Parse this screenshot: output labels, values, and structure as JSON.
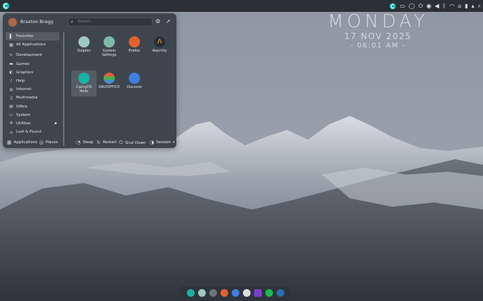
{
  "panel": {
    "tray_icons": [
      "cachyos-icon",
      "monitor-icon",
      "circle-icon",
      "power-icon",
      "eye-icon",
      "volume-icon",
      "bluetooth-icon",
      "wifi-icon",
      "hub-icon",
      "battery-icon",
      "expand-icon",
      "search-icon"
    ]
  },
  "clock": {
    "day": "MONDAY",
    "date": "17 NOV 2025",
    "time": "- 06:01 AM -"
  },
  "menu": {
    "user_name": "Braxton Bragg",
    "search_placeholder": "Search...",
    "categories": [
      {
        "label": "Favorites",
        "icon": "bookmark-icon"
      },
      {
        "label": "All Applications",
        "icon": "grid-icon"
      },
      {
        "label": "Development",
        "icon": "wrench-icon"
      },
      {
        "label": "Games",
        "icon": "gamepad-icon"
      },
      {
        "label": "Graphics",
        "icon": "palette-icon"
      },
      {
        "label": "Help",
        "icon": "help-icon"
      },
      {
        "label": "Internet",
        "icon": "globe-icon"
      },
      {
        "label": "Multimedia",
        "icon": "multimedia-icon"
      },
      {
        "label": "Office",
        "icon": "document-icon"
      },
      {
        "label": "System",
        "icon": "computer-icon"
      },
      {
        "label": "Utilities",
        "icon": "utilities-icon"
      },
      {
        "label": "Lost & Found",
        "icon": "lost-found-icon"
      }
    ],
    "apps": [
      {
        "label": "Dolphin",
        "color": "#9fc9c0"
      },
      {
        "label": "System Settings",
        "color": "#7fb8a9"
      },
      {
        "label": "Firefox",
        "color": "#e4612f"
      },
      {
        "label": "Alacritty",
        "color": "#2b2f33"
      },
      {
        "label": "CachyOS Hello",
        "color": "#19b3a5"
      },
      {
        "label": "ONLYOFFICE",
        "color": "#f0b43a"
      },
      {
        "label": "Discover",
        "color": "#3f7fe0"
      }
    ],
    "footer": {
      "applications": "Applications",
      "places": "Places",
      "sleep": "Sleep",
      "restart": "Restart",
      "shutdown": "Shut Down",
      "session": "Session"
    }
  },
  "dock": {
    "icons": [
      {
        "name": "cachyos-hello-dock-icon",
        "color": "#19b3a5"
      },
      {
        "name": "dolphin-dock-icon",
        "color": "#9fc9c0"
      },
      {
        "name": "settings-dock-icon",
        "color": "#6b737b"
      },
      {
        "name": "firefox-dock-icon",
        "color": "#e4612f"
      },
      {
        "name": "discover-dock-icon",
        "color": "#3f7fe0"
      },
      {
        "name": "steam-client-dock-icon",
        "color": "#d9dde1"
      },
      {
        "name": "purple-app-dock-icon",
        "color": "#7b3fd0"
      },
      {
        "name": "spotify-dock-icon",
        "color": "#1db954"
      },
      {
        "name": "steam-dock-icon",
        "color": "#2a6db0"
      }
    ]
  }
}
